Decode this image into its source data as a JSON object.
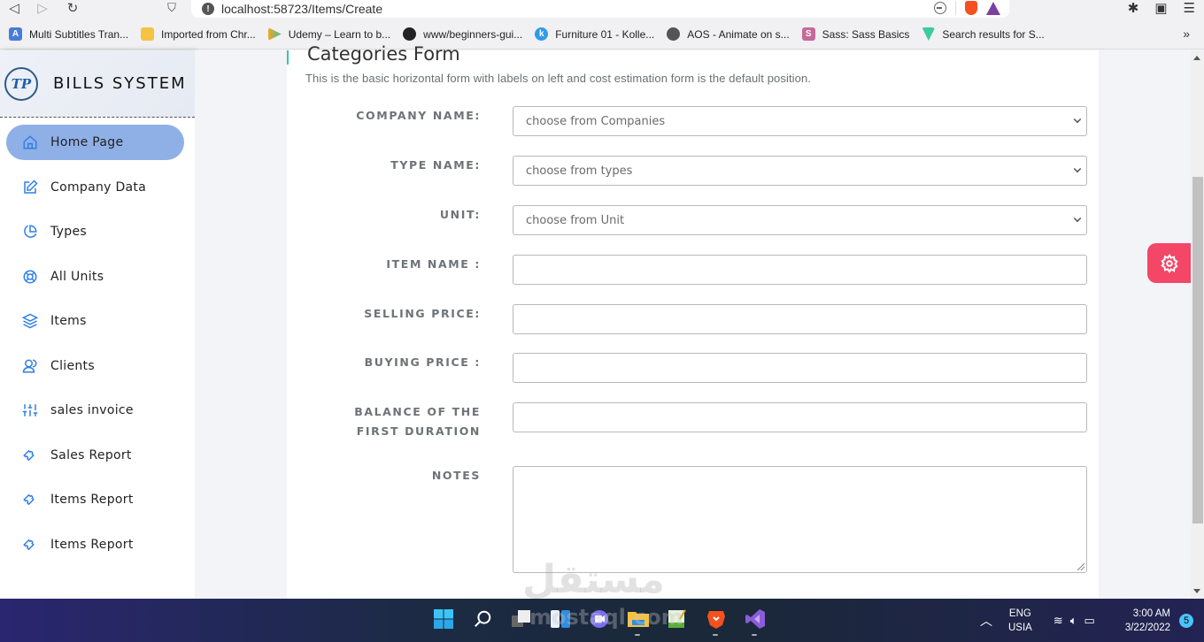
{
  "browser": {
    "url": "localhost:58723/Items/Create",
    "bookmarks": [
      {
        "label": "Multi Subtitles Tran...",
        "icon": "translate-icon",
        "color": "#4a7bd8"
      },
      {
        "label": "Imported from Chr...",
        "icon": "folder-icon",
        "color": "#f5c242"
      },
      {
        "label": "Udemy – Learn to b...",
        "icon": "udemy-icon",
        "color": "#3ec1a0"
      },
      {
        "label": "www/beginners-gui...",
        "icon": "github-icon",
        "color": "#222222"
      },
      {
        "label": "Furniture 01 - Kolle...",
        "icon": "kollektiv-icon",
        "color": "#2f9be8"
      },
      {
        "label": "AOS - Animate on s...",
        "icon": "globe-icon",
        "color": "#555555"
      },
      {
        "label": "Sass: Sass Basics",
        "icon": "sass-icon",
        "color": "#c56a9a"
      },
      {
        "label": "Search results for S...",
        "icon": "vuetify-icon",
        "color": "#3ec9a0"
      }
    ],
    "more": "»"
  },
  "sidebar": {
    "brand": "BILLS SYSTEM",
    "logo_text": "TP",
    "items": [
      {
        "label": "Home Page",
        "icon": "home-icon",
        "active": true
      },
      {
        "label": "Company Data",
        "icon": "edit-icon"
      },
      {
        "label": "Types",
        "icon": "pie-chart-icon"
      },
      {
        "label": "All Units",
        "icon": "lifebuoy-icon"
      },
      {
        "label": "Items",
        "icon": "layers-icon"
      },
      {
        "label": "Clients",
        "icon": "users-icon"
      },
      {
        "label": "sales invoice",
        "icon": "sliders-icon"
      },
      {
        "label": "Sales Report",
        "icon": "puzzle-icon"
      },
      {
        "label": "Items Report",
        "icon": "puzzle-icon"
      },
      {
        "label": "Items Report",
        "icon": "puzzle-icon"
      }
    ]
  },
  "form": {
    "title": "Categories Form",
    "description": "This is the basic horizontal form with labels on left and cost estimation form is the default position.",
    "fields": [
      {
        "label": "COMPANY NAME:",
        "type": "select",
        "value": "choose from Companies"
      },
      {
        "label": "TYPE NAME:",
        "type": "select",
        "value": "choose from types"
      },
      {
        "label": "UNIT:",
        "type": "select",
        "value": "choose from Unit"
      },
      {
        "label": "ITEM NAME :",
        "type": "text",
        "value": ""
      },
      {
        "label": "SELLING PRICE:",
        "type": "text",
        "value": ""
      },
      {
        "label": "BUYING PRICE :",
        "type": "text",
        "value": ""
      },
      {
        "label": "BALANCE OF THE FIRST DURATION",
        "type": "text",
        "value": ""
      },
      {
        "label": "NOTES",
        "type": "textarea",
        "value": ""
      }
    ]
  },
  "colors": {
    "accent": "#8fb0e6",
    "icon_blue": "#2f7ee8",
    "settings_button": "#f44667",
    "title_accent": "#38c7a0"
  },
  "watermark": {
    "arabic": "مستقل",
    "latin": "mostaql.com"
  },
  "taskbar": {
    "lang_line1": "ENG",
    "lang_line2": "USIA",
    "time": "3:00 AM",
    "date": "3/22/2022",
    "notifications": "5"
  }
}
